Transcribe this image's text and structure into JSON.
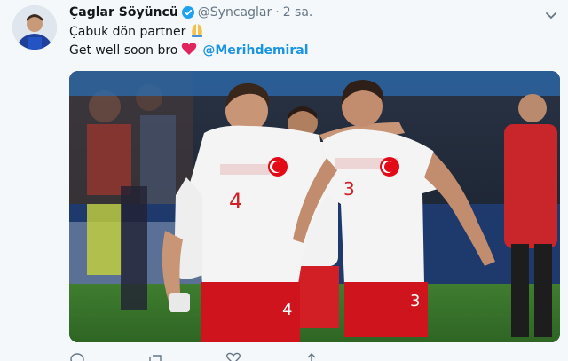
{
  "tweet": {
    "author_name": "Çaglar Söyüncü",
    "handle": "@Syncaglar",
    "separator": "·",
    "time": "2 sa.",
    "text_line1": "Çabuk dön partner",
    "text_line2": "Get well soon bro",
    "mention": "@Merihdemiral",
    "jersey_left": "4",
    "jersey_right": "3"
  },
  "icons": {
    "verified": "verified-badge-icon",
    "caret": "chevron-down-icon",
    "pray": "folded-hands-emoji",
    "heart": "red-heart-emoji",
    "reply": "reply-icon",
    "retweet": "retweet-icon",
    "like": "like-icon",
    "share": "share-icon"
  },
  "colors": {
    "link": "#1b95e0",
    "verified": "#1da1f2",
    "muted": "#657786",
    "turkey_red": "#e30a17"
  }
}
